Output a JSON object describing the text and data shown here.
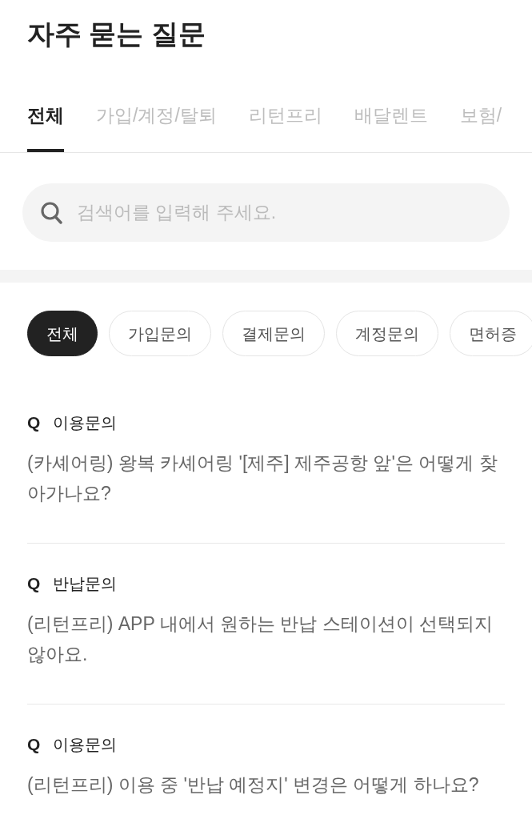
{
  "page": {
    "title": "자주 묻는 질문"
  },
  "tabs": [
    {
      "label": "전체",
      "selected": true
    },
    {
      "label": "가입/계정/탈퇴",
      "selected": false
    },
    {
      "label": "리턴프리",
      "selected": false
    },
    {
      "label": "배달렌트",
      "selected": false
    },
    {
      "label": "보험/",
      "selected": false
    }
  ],
  "search": {
    "placeholder": "검색어를 입력해 주세요."
  },
  "filters": [
    {
      "label": "전체",
      "selected": true
    },
    {
      "label": "가입문의",
      "selected": false
    },
    {
      "label": "결제문의",
      "selected": false
    },
    {
      "label": "계정문의",
      "selected": false
    },
    {
      "label": "면허증",
      "selected": false
    }
  ],
  "questions": [
    {
      "prefix": "Q",
      "category": "이용문의",
      "text": "(카셰어링) 왕복 카셰어링 '[제주] 제주공항 앞'은 어떻게 찾아가나요?"
    },
    {
      "prefix": "Q",
      "category": "반납문의",
      "text": "(리턴프리) APP 내에서 원하는 반납 스테이션이 선택되지 않아요."
    },
    {
      "prefix": "Q",
      "category": "이용문의",
      "text": "(리턴프리) 이용 중 '반납 예정지' 변경은 어떻게 하나요?"
    }
  ]
}
